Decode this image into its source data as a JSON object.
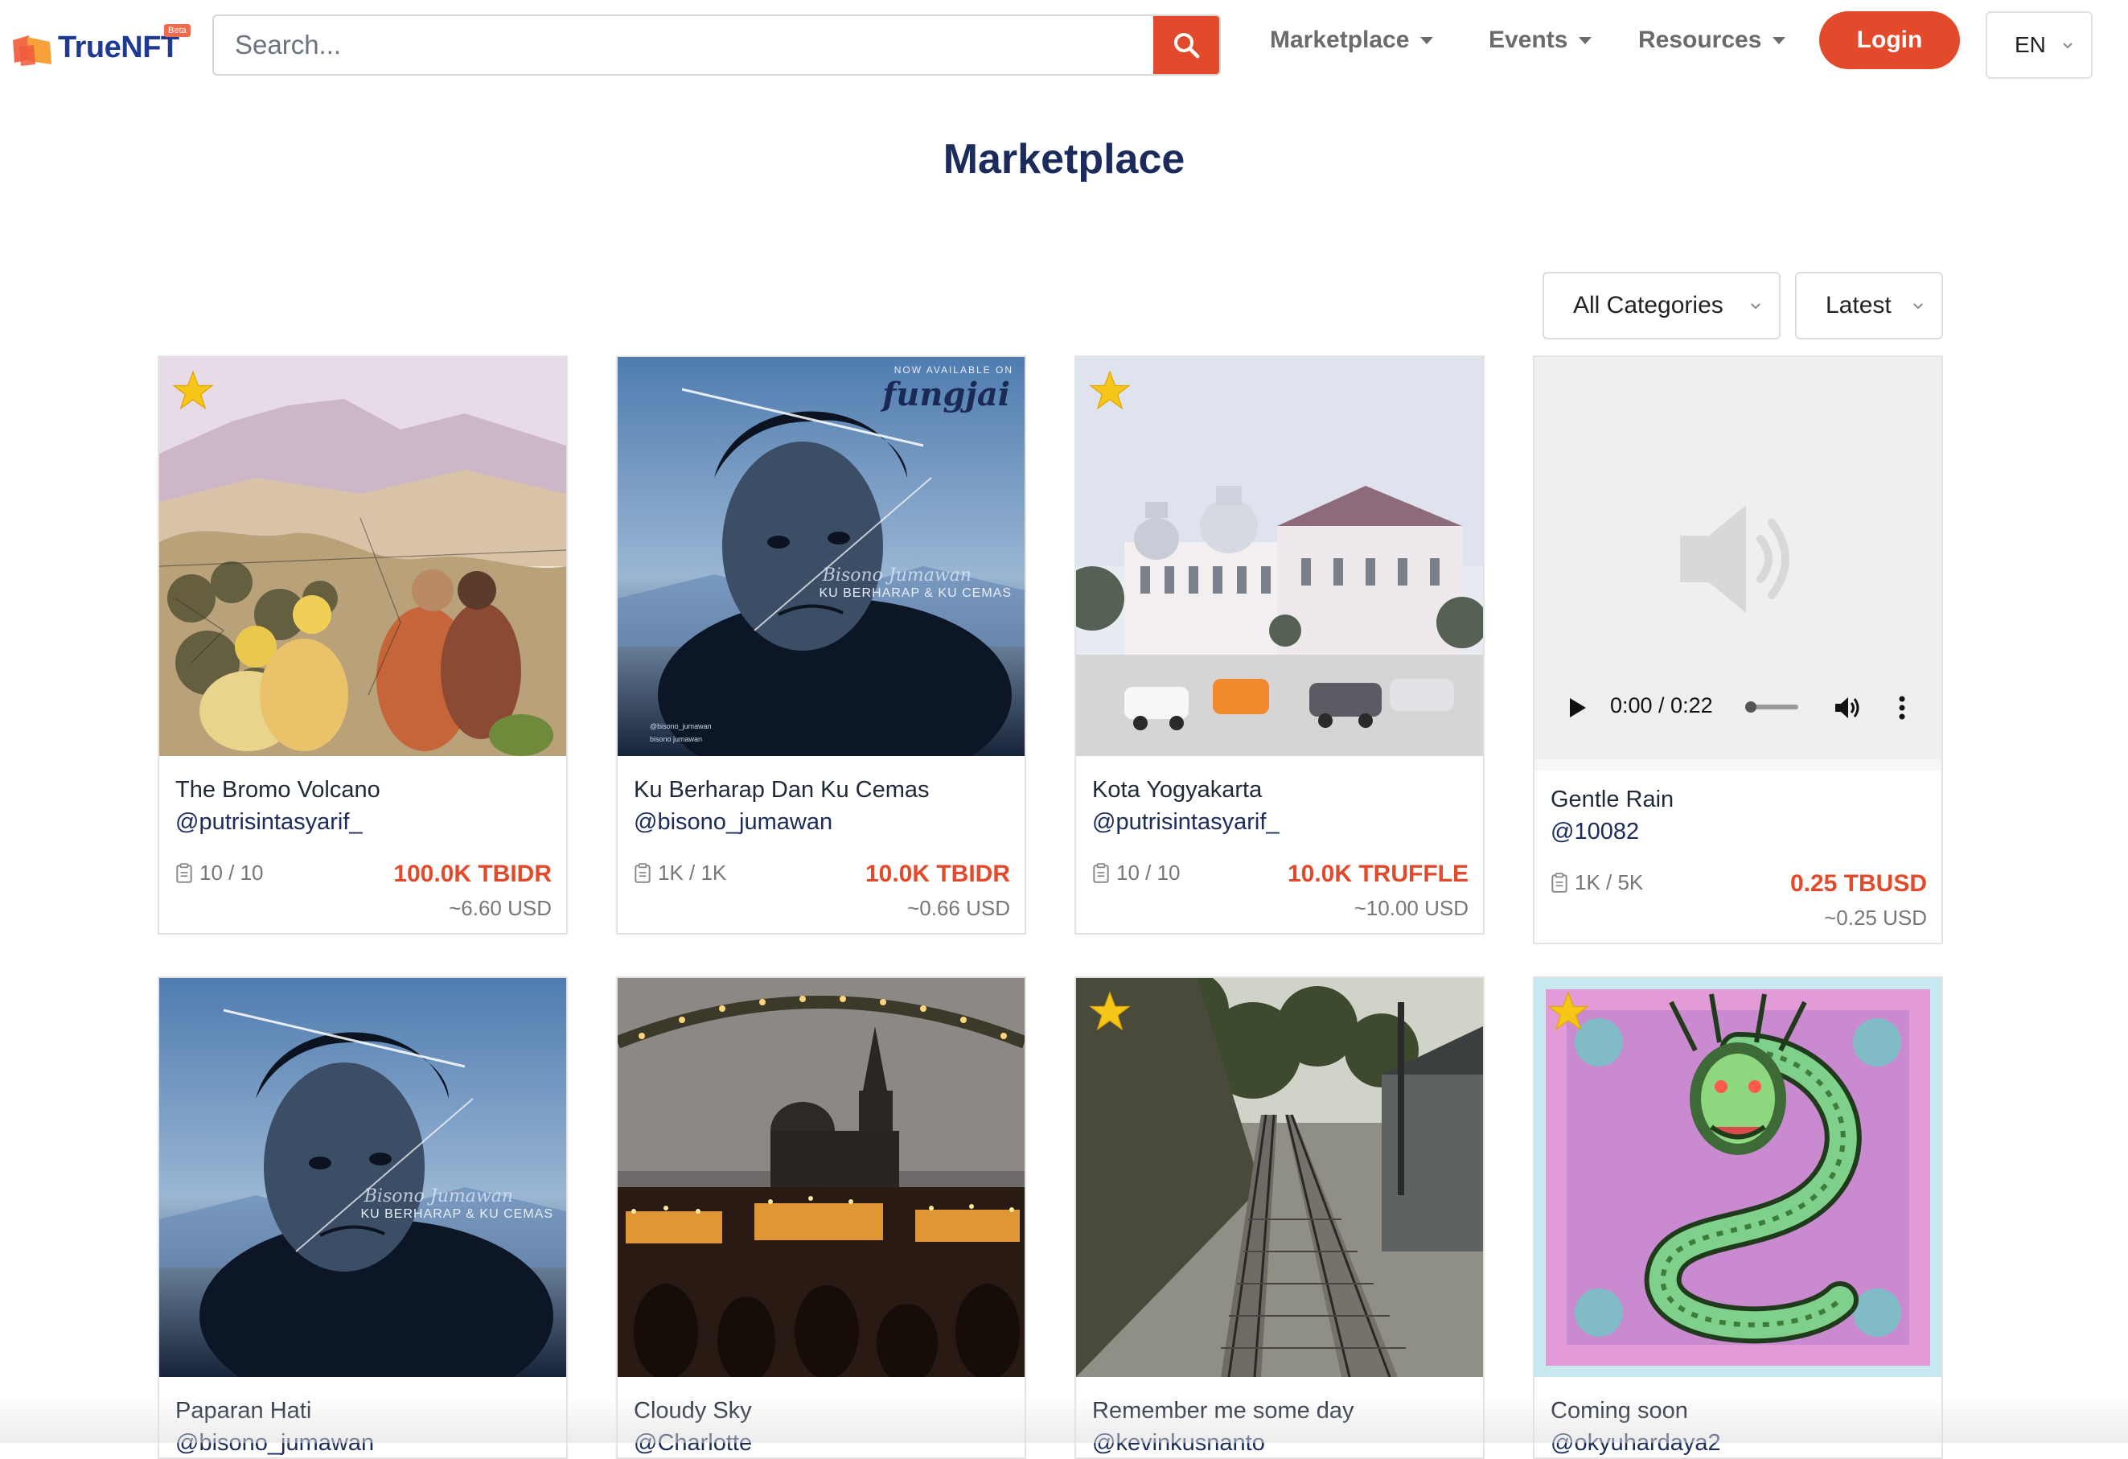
{
  "header": {
    "logo_text": "TrueNFT",
    "logo_badge": "Beta",
    "search_placeholder": "Search...",
    "nav": [
      "Marketplace",
      "Events",
      "Resources"
    ],
    "login_label": "Login",
    "language": "EN"
  },
  "page": {
    "title": "Marketplace",
    "category_filter": "All Categories",
    "sort_filter": "Latest"
  },
  "cards": [
    {
      "title": "The Bromo Volcano",
      "owner": "@putrisintasyarif_",
      "editions": "10 / 10",
      "price": "100.0K TBIDR",
      "usd": "~6.60 USD",
      "featured": true,
      "image": "volcano-painting"
    },
    {
      "title": "Ku Berharap Dan Ku Cemas",
      "owner": "@bisono_jumawan",
      "editions": "1K / 1K",
      "price": "10.0K TBIDR",
      "usd": "~0.66 USD",
      "featured": false,
      "image": "album-cover-portrait"
    },
    {
      "title": "Kota Yogyakarta",
      "owner": "@putrisintasyarif_",
      "editions": "10 / 10",
      "price": "10.0K TRUFFLE",
      "usd": "~10.00 USD",
      "featured": true,
      "image": "city-building-painting"
    },
    {
      "title": "Gentle Rain",
      "owner": "@10082",
      "editions": "1K / 5K",
      "price": "0.25 TBUSD",
      "usd": "~0.25 USD",
      "featured": false,
      "image": "audio-player",
      "audio_time": "0:00 / 0:22"
    },
    {
      "title": "Paparan Hati",
      "owner": "@bisono_jumawan",
      "featured": false,
      "image": "album-cover-portrait"
    },
    {
      "title": "Cloudy Sky",
      "owner": "@Charlotte",
      "featured": false,
      "image": "christmas-market-church"
    },
    {
      "title": "Remember me some day",
      "owner": "@kevinkusnanto",
      "featured": true,
      "image": "railway-tracks"
    },
    {
      "title": "Coming soon",
      "owner": "@okyuhardaya2",
      "featured": true,
      "image": "dragon-artwork"
    }
  ],
  "album_text": {
    "available": "NOW AVAILABLE ON",
    "brand": "fungjai",
    "signature": "Bisono Jumawan",
    "subtitle": "KU BERHARAP & KU CEMAS",
    "social_1": "@bisono_jumawan",
    "social_2": "bisono jumawan"
  },
  "colors": {
    "accent": "#e24a2b",
    "title_navy": "#1a2b5c",
    "logo_blue": "#1f3a93",
    "muted": "#777777"
  },
  "icons": [
    "search-icon",
    "caret-down-icon",
    "star-icon",
    "edition-icon",
    "play-icon",
    "volume-icon",
    "more-icon",
    "speaker-placeholder-icon"
  ]
}
